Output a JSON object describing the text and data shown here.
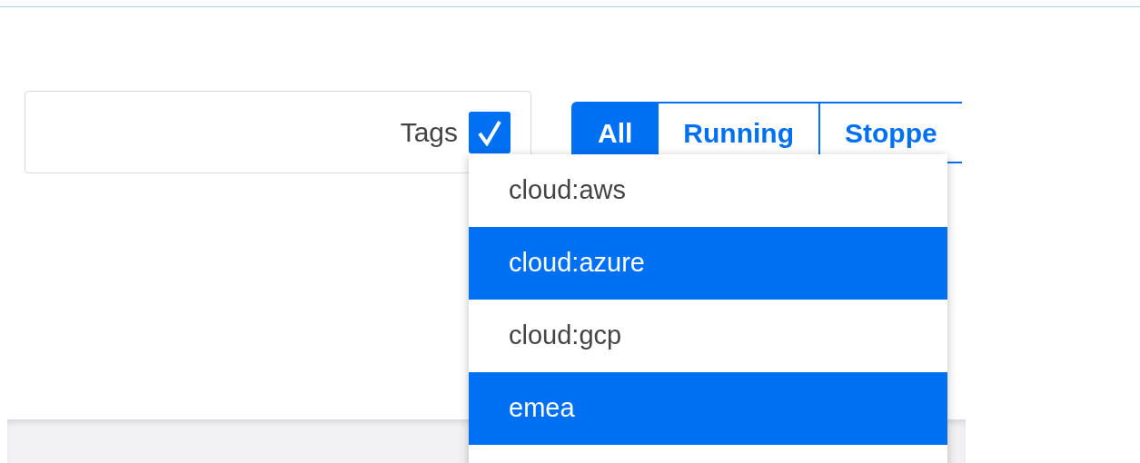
{
  "filter": {
    "label": "Tags",
    "checked": true
  },
  "tabs": [
    {
      "label": "All",
      "selected": true
    },
    {
      "label": "Running",
      "selected": false
    },
    {
      "label": "Stoppe",
      "selected": false
    }
  ],
  "dropdown": {
    "items": [
      {
        "label": "cloud:aws",
        "selected": false
      },
      {
        "label": "cloud:azure",
        "selected": true
      },
      {
        "label": "cloud:gcp",
        "selected": false
      },
      {
        "label": "emea",
        "selected": true
      }
    ]
  }
}
